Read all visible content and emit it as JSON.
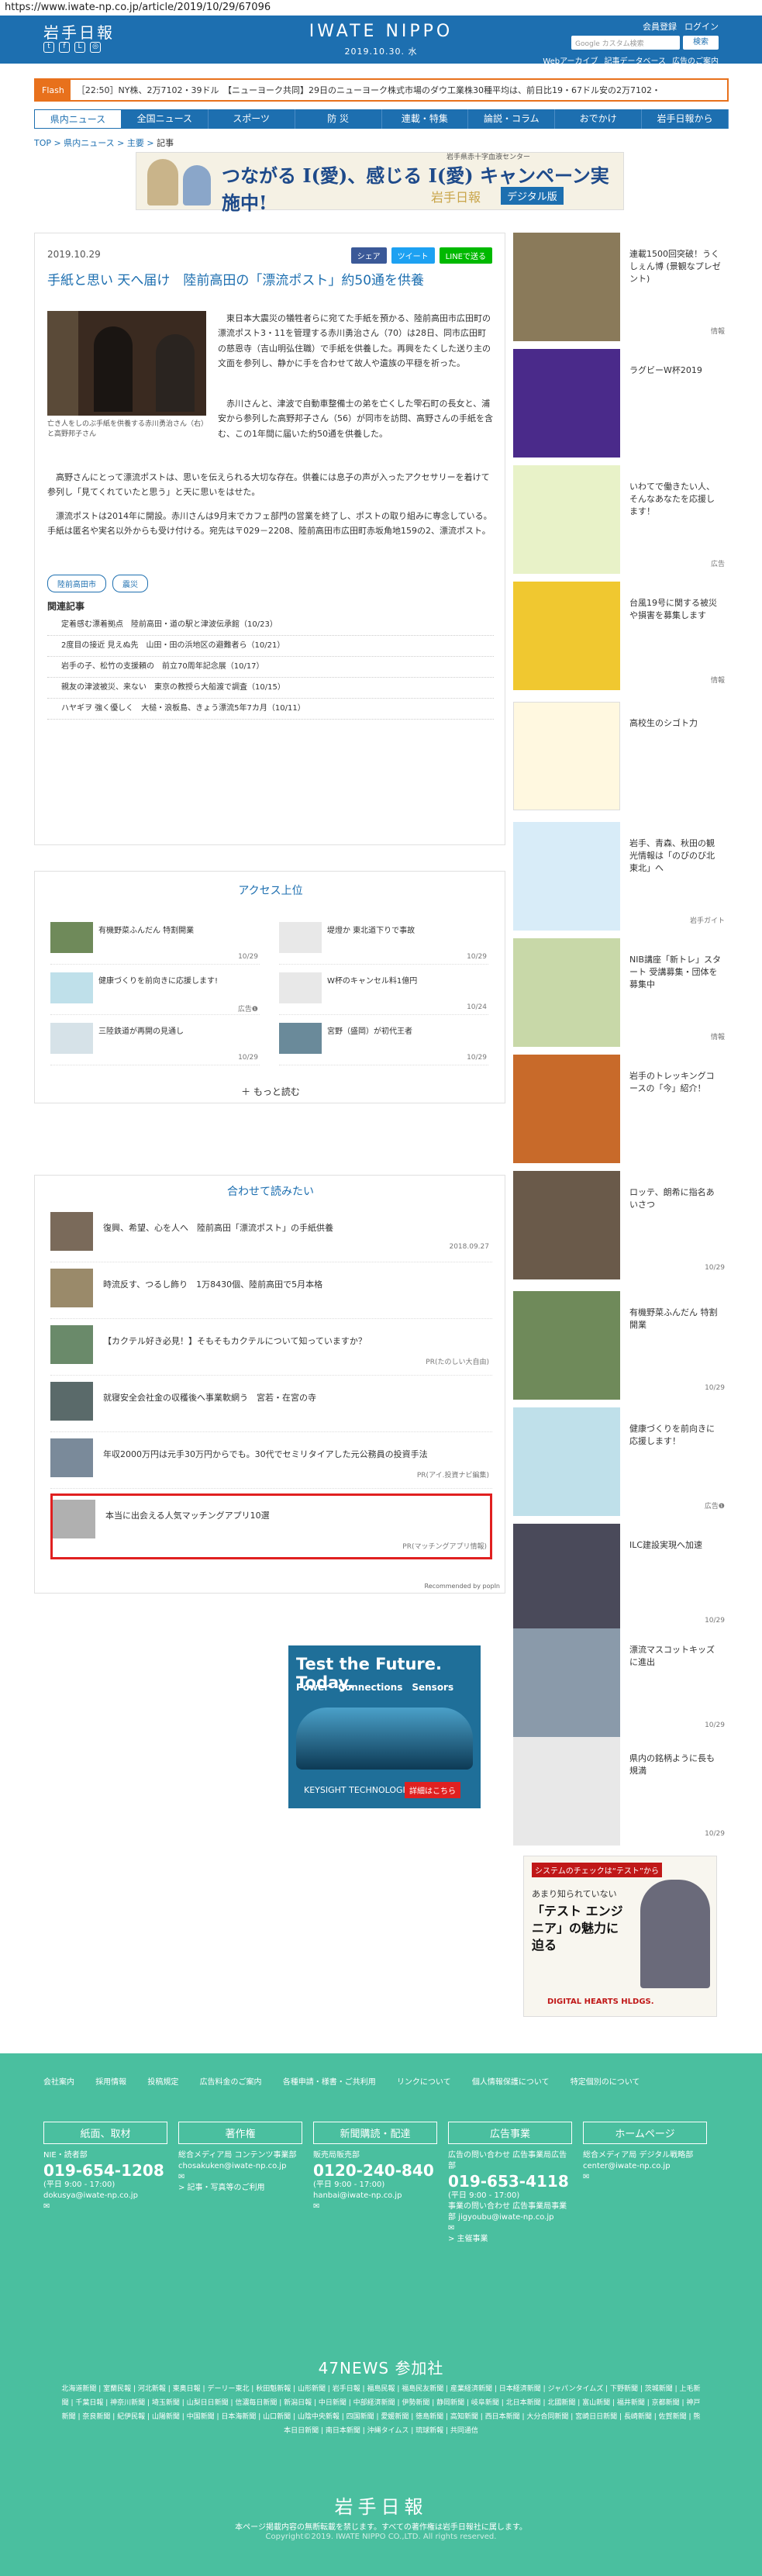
{
  "url": "https://www.iwate-np.co.jp/article/2019/10/29/67096",
  "header": {
    "logo_left": "岩手日報",
    "logo_center": "IWATE NIPPO",
    "date": "2019.10.30. 水",
    "links": [
      "会員登録",
      "ログイン"
    ],
    "search_placeholder": "Google カスタム検索",
    "search_button": "検索",
    "sub_links": [
      "Webアーカイブ",
      "記事データベース",
      "広告のご案内"
    ]
  },
  "flash": {
    "label": "Flash",
    "text": "［22:50］NY株、2万7102・39ドル　【ニューヨーク共同】29日のニューヨーク株式市場のダウ工業株30種平均は、前日比19・67ドル安の2万7102・"
  },
  "nav": [
    "県内ニュース",
    "全国ニュース",
    "スポーツ",
    "防 災",
    "連載・特集",
    "論説・コラム",
    "おでかけ",
    "岩手日報から"
  ],
  "breadcrumb": [
    "TOP",
    "県内ニュース",
    "主要",
    "記事"
  ],
  "banner": {
    "small": "岩手県赤十字血液センター",
    "title": "つながる I(愛)、感じる I(愛) キャンペーン実施中!",
    "sub": "岩手日報",
    "tag": "デジタル版"
  },
  "article": {
    "date": "2019.10.29",
    "share": [
      "シェア",
      "ツイート",
      "LINEで送る"
    ],
    "title": "手紙と思い 天へ届け　陸前高田の「漂流ポスト」約50通を供養",
    "caption": "亡き人をしのぶ手紙を供養する赤川勇治さん（右）と高野邦子さん",
    "p1": "　東日本大震災の犠牲者らに宛てた手紙を預かる、陸前高田市広田町の漂流ポスト3・11を管理する赤川勇治さん（70）は28日、同市広田町の慈恩寺（吉山明弘住職）で手紙を供養した。再興をたくした送り主の文面を参列し、静かに手を合わせて故人や遺族の平穏を祈った。",
    "p2": "　赤川さんと、津波で自動車整備士の弟を亡くした雫石町の長女と、浦安から参列した高野邦子さん（56）が同市を訪問、高野さんの手紙を含む、この1年間に届いた約50通を供養した。",
    "p3": "　高野さんにとって漂流ポストは、思いを伝えられる大切な存在。供養には息子の声が入ったアクセサリーを着けて参列し「見てくれていたと思う」と天に思いをはせた。",
    "p4": "　漂流ポストは2014年に開設。赤川さんは9月末でカフェ部門の営業を終了し、ポストの取り組みに専念している。手紙は匿名や実名以外からも受け付ける。宛先は〒029－2208、陸前高田市広田町赤坂角地159の2、漂流ポスト。",
    "tags": [
      "陸前高田市",
      "震災"
    ],
    "related_title": "関連記事",
    "related": [
      "定着感む漂着拠点　陸前高田・道の駅と津波伝承館（10/23）",
      "2度目の接近 見えぬ先　山田・田の浜地区の避難者ら（10/21）",
      "岩手の子、松竹の支援頼の　前立70周年記念展（10/17）",
      "親友の津波被災、来ない　東京の教授ら大船渡で調査（10/15）",
      "ハヤギヲ 強く優しく　大槌・浪板島、きょう漂流5年7カ月（10/11）"
    ]
  },
  "ranking": {
    "title": "アクセス上位",
    "items": [
      {
        "text": "有機野菜ふんだん 特割開業",
        "date": "10/29"
      },
      {
        "text": "堤燈か 東北道下りで事故",
        "date": "10/29"
      },
      {
        "text": "健康づくりを前向きに応援します!",
        "date": "広告❶"
      },
      {
        "text": "W杯のキャンセル料1億円",
        "date": "10/24"
      },
      {
        "text": "三陸鉄道が再開の見通し",
        "date": "10/29"
      },
      {
        "text": "宮野（盛岡）が初代王者",
        "date": "10/29"
      }
    ],
    "more": "もっと読む"
  },
  "awase": {
    "title": "合わせて読みたい",
    "items": [
      {
        "text": "復興、希望、心を人へ　陸前高田「漂流ポスト」の手紙供養",
        "date": "2018.09.27"
      },
      {
        "text": "時流反す、つるし飾り　1万8430個、陸前高田で5月本格",
        "date": ""
      },
      {
        "text": "【カクテル好き必見！】そもそもカクテルについて知っていますか？",
        "date": "PR(たのしい大自由)"
      },
      {
        "text": "就寝安全会社金の収穫後へ事業軟網う　宮若・在宮の寺",
        "date": ""
      },
      {
        "text": "年収2000万円は元手30万円からでも。30代でセミリタイアした元公務員の投資手法",
        "date": "PR(アイ.投資ナビ編集)"
      },
      {
        "text": "本当に出会える人気マッチングアプリ10選",
        "date": "PR(マッチングアプリ情報)"
      }
    ],
    "popin": "Recommended by popIn"
  },
  "keysight": {
    "head": "Test the Future. Today.",
    "sub": "Power　Connections　Sensors",
    "logo": "KEYSIGHT TECHNOLOGIES",
    "btn": "詳細はこちら"
  },
  "sidebar": [
    {
      "text": "連載1500回突破！うくしぇん博 (景観なプレゼント)",
      "date": "情報"
    },
    {
      "text": "ラグビーW杯2019",
      "date": ""
    },
    {
      "text": "いわてで働きたい人、そんなあなたを応援します！",
      "date": "広告"
    },
    {
      "text": "台風19号に関する被災や損害を募集します",
      "date": "情報"
    },
    {
      "text": "高校生のシゴト力",
      "date": ""
    },
    {
      "text": "岩手、青森、秋田の観光情報は「のびのび北東北」へ",
      "date": "岩手ガイト"
    },
    {
      "text": "NIB講座「新トレ」スタート 受講募集・団体を募集中",
      "date": "情報"
    },
    {
      "text": "岩手のトレッキングコースの「今」紹介！",
      "date": ""
    },
    {
      "text": "ロッテ、朗希に指名あいさつ",
      "date": "10/29"
    },
    {
      "text": "有機野菜ふんだん 特割開業",
      "date": "10/29"
    },
    {
      "text": "健康づくりを前向きに応援します！",
      "date": "広告❶"
    },
    {
      "text": "ILC建設実現へ加速",
      "date": "10/29"
    },
    {
      "text": "漂流マスコットキッズに進出",
      "date": "10/29"
    },
    {
      "text": "県内の銘柄ように長も規満",
      "date": "10/29"
    }
  ],
  "ad_dh": {
    "line1": "システムのチェックは“テスト”から",
    "line2": "あまり知られていない",
    "line3": "「テスト エンジニア」の魅力に迫る",
    "logo": "DIGITAL HEARTS HLDGS."
  },
  "footer": {
    "links": [
      "会社案内",
      "採用情報",
      "投稿規定",
      "広告料金のご案内",
      "各種申請・様書・ご共利用",
      "リンクについて",
      "個人情報保護について",
      "特定個別のについて"
    ],
    "cols": [
      {
        "head": "紙面、取材",
        "sub": "NIE・読者部",
        "tel": "019-654-1208",
        "hours": "(平日 9:00 - 17:00)",
        "mail": "dokusya@iwate-np.co.jp"
      },
      {
        "head": "著作権",
        "sub": "総合メディア局 コンテンツ事業部",
        "tel": "",
        "hours": "",
        "mail": "chosakuken@iwate-np.co.jp",
        "extra": "> 記事・写真等のご利用"
      },
      {
        "head": "新聞購読・配達",
        "sub": "販売局販売部",
        "tel": "0120-240-840",
        "hours": "(平日 9:00 - 17:00)",
        "mail": "hanbai@iwate-np.co.jp"
      },
      {
        "head": "広告事業",
        "sub": "広告の問い合わせ 広告事業局広告部",
        "tel": "019-653-4118",
        "hours": "(平日 9:00 - 17:00)",
        "mail": "事業の問い合わせ 広告事業局事業部 jigyoubu@iwate-np.co.jp",
        "extra": "> 主催事業"
      },
      {
        "head": "ホームページ",
        "sub": "総合メディア局 デジタル戦略部",
        "tel": "",
        "hours": "",
        "mail": "center@iwate-np.co.jp"
      }
    ],
    "n47_title": "47NEWS 参加社",
    "n47_list": "北海道新聞 | 室蘭民報 | 河北新報 | 東奥日報 | デーリー東北 | 秋田魁新報 | 山形新聞 | 岩手日報 | 福島民報 | 福島民友新聞 | 産業経済新聞 | 日本経済新聞 | ジャパンタイムズ | 下野新聞 | 茨城新聞 | 上毛新聞 | 千葉日報 | 神奈川新聞 | 埼玉新聞 | 山梨日日新聞 | 信濃毎日新聞 | 新潟日報 | 中日新聞 | 中部経済新聞 | 伊勢新聞 | 静岡新聞 | 岐阜新聞 | 北日本新聞 | 北國新聞 | 富山新聞 | 福井新聞 | 京都新聞 | 神戸新聞 | 奈良新聞 | 紀伊民報 | 山陽新聞 | 中国新聞 | 日本海新聞 | 山口新聞 | 山陰中央新報 | 四国新聞 | 愛媛新聞 | 徳島新聞 | 高知新聞 | 西日本新聞 | 大分合同新聞 | 宮崎日日新聞 | 長崎新聞 | 佐賀新聞 | 熊本日日新聞 | 南日本新聞 | 沖縄タイムス | 琉球新報 | 共同通信",
    "logo": "岩手日報",
    "copy1": "本ページ掲載内容の無断転載を禁じます。すべての著作権は岩手日報社に属します。",
    "copy2": "Copyright©2019. IWATE NIPPO CO.,LTD. All rights reserved."
  }
}
